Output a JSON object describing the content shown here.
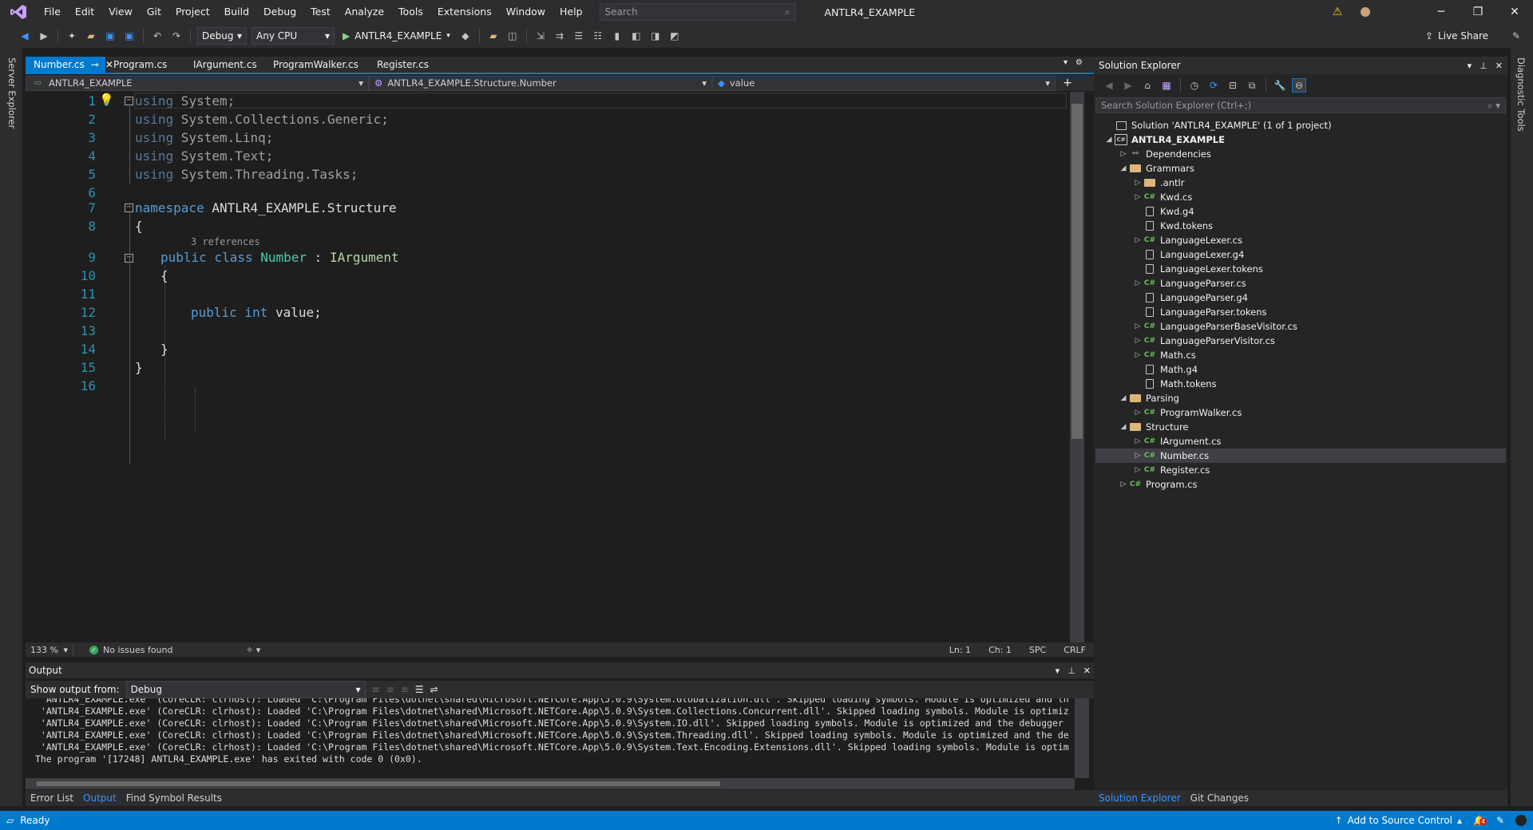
{
  "menu": {
    "items": [
      "File",
      "Edit",
      "View",
      "Git",
      "Project",
      "Build",
      "Debug",
      "Test",
      "Analyze",
      "Tools",
      "Extensions",
      "Window",
      "Help"
    ],
    "search_placeholder": "Search",
    "app_title": "ANTLR4_EXAMPLE"
  },
  "toolbar": {
    "config": "Debug",
    "platform": "Any CPU",
    "run_target": "ANTLR4_EXAMPLE",
    "live_share": "Live Share"
  },
  "side": {
    "left_label": "Server Explorer",
    "right_label": "Diagnostic Tools"
  },
  "tabs": [
    {
      "label": "Number.cs",
      "active": true
    },
    {
      "label": "Program.cs"
    },
    {
      "label": "IArgument.cs"
    },
    {
      "label": "ProgramWalker.cs"
    },
    {
      "label": "Register.cs"
    }
  ],
  "navbar": {
    "project": "ANTLR4_EXAMPLE",
    "type": "ANTLR4_EXAMPLE.Structure.Number",
    "member": "value"
  },
  "editor": {
    "line_numbers": [
      "1",
      "2",
      "3",
      "4",
      "5",
      "6",
      "7",
      "8",
      "9",
      "10",
      "11",
      "12",
      "13",
      "14",
      "15",
      "16"
    ],
    "codelens": "3 references",
    "zoom": "133 %",
    "issues": "No issues found",
    "ln": "Ln: 1",
    "ch": "Ch: 1",
    "spc": "SPC",
    "crlf": "CRLF"
  },
  "code": {
    "l1_kw": "using",
    "l1_rest": " System;",
    "l2_kw": "using",
    "l2_rest": " System.Collections.Generic;",
    "l3_kw": "using",
    "l3_rest": " System.Linq;",
    "l4_kw": "using",
    "l4_rest": " System.Text;",
    "l5_kw": "using",
    "l5_rest": " System.Threading.Tasks;",
    "l7_kw": "namespace",
    "l7_rest": " ANTLR4_EXAMPLE.Structure",
    "l8": "{",
    "l9_kw": "public class",
    "l9_type": "Number",
    "l9_colon": " : ",
    "l9_iface": "IArgument",
    "l10": "{",
    "l12_kw": "public int",
    "l12_rest": " value;",
    "l14": "}",
    "l15": "}"
  },
  "output": {
    "title": "Output",
    "show_from_label": "Show output from:",
    "source": "Debug",
    "lines": [
      " 'ANTLR4_EXAMPLE.exe' (CoreCLR: clrhost): Loaded 'C:\\Program Files\\dotnet\\shared\\Microsoft.NETCore.App\\5.0.9\\System.Globalization.dll'. Skipped loading symbols. Module is optimized and th",
      " 'ANTLR4_EXAMPLE.exe' (CoreCLR: clrhost): Loaded 'C:\\Program Files\\dotnet\\shared\\Microsoft.NETCore.App\\5.0.9\\System.Collections.Concurrent.dll'. Skipped loading symbols. Module is optimiz",
      " 'ANTLR4_EXAMPLE.exe' (CoreCLR: clrhost): Loaded 'C:\\Program Files\\dotnet\\shared\\Microsoft.NETCore.App\\5.0.9\\System.IO.dll'. Skipped loading symbols. Module is optimized and the debugger",
      " 'ANTLR4_EXAMPLE.exe' (CoreCLR: clrhost): Loaded 'C:\\Program Files\\dotnet\\shared\\Microsoft.NETCore.App\\5.0.9\\System.Threading.dll'. Skipped loading symbols. Module is optimized and the de",
      " 'ANTLR4_EXAMPLE.exe' (CoreCLR: clrhost): Loaded 'C:\\Program Files\\dotnet\\shared\\Microsoft.NETCore.App\\5.0.9\\System.Text.Encoding.Extensions.dll'. Skipped loading symbols. Module is optim",
      "The program '[17248] ANTLR4_EXAMPLE.exe' has exited with code 0 (0x0)."
    ]
  },
  "bottom_tabs": [
    "Error List",
    "Output",
    "Find Symbol Results"
  ],
  "solution_explorer": {
    "title": "Solution Explorer",
    "search_placeholder": "Search Solution Explorer (Ctrl+;)",
    "tree": [
      {
        "label": "Solution 'ANTLR4_EXAMPLE' (1 of 1 project)",
        "depth": 0,
        "icon": "solution",
        "exp": ""
      },
      {
        "label": "ANTLR4_EXAMPLE",
        "depth": 0,
        "icon": "project",
        "exp": "open",
        "bold": true
      },
      {
        "label": "Dependencies",
        "depth": 1,
        "icon": "deps",
        "exp": "closed"
      },
      {
        "label": "Grammars",
        "depth": 1,
        "icon": "folder",
        "exp": "open"
      },
      {
        "label": ".antlr",
        "depth": 2,
        "icon": "folder",
        "exp": "closed"
      },
      {
        "label": "Kwd.cs",
        "depth": 2,
        "icon": "cs",
        "exp": "closed"
      },
      {
        "label": "Kwd.g4",
        "depth": 2,
        "icon": "file",
        "exp": ""
      },
      {
        "label": "Kwd.tokens",
        "depth": 2,
        "icon": "file",
        "exp": ""
      },
      {
        "label": "LanguageLexer.cs",
        "depth": 2,
        "icon": "cs",
        "exp": "closed"
      },
      {
        "label": "LanguageLexer.g4",
        "depth": 2,
        "icon": "file",
        "exp": ""
      },
      {
        "label": "LanguageLexer.tokens",
        "depth": 2,
        "icon": "file",
        "exp": ""
      },
      {
        "label": "LanguageParser.cs",
        "depth": 2,
        "icon": "cs",
        "exp": "closed"
      },
      {
        "label": "LanguageParser.g4",
        "depth": 2,
        "icon": "file",
        "exp": ""
      },
      {
        "label": "LanguageParser.tokens",
        "depth": 2,
        "icon": "file",
        "exp": ""
      },
      {
        "label": "LanguageParserBaseVisitor.cs",
        "depth": 2,
        "icon": "cs",
        "exp": "closed"
      },
      {
        "label": "LanguageParserVisitor.cs",
        "depth": 2,
        "icon": "cs",
        "exp": "closed"
      },
      {
        "label": "Math.cs",
        "depth": 2,
        "icon": "cs",
        "exp": "closed"
      },
      {
        "label": "Math.g4",
        "depth": 2,
        "icon": "file",
        "exp": ""
      },
      {
        "label": "Math.tokens",
        "depth": 2,
        "icon": "file",
        "exp": ""
      },
      {
        "label": "Parsing",
        "depth": 1,
        "icon": "folder",
        "exp": "open"
      },
      {
        "label": "ProgramWalker.cs",
        "depth": 2,
        "icon": "cs",
        "exp": "closed"
      },
      {
        "label": "Structure",
        "depth": 1,
        "icon": "folder",
        "exp": "open"
      },
      {
        "label": "IArgument.cs",
        "depth": 2,
        "icon": "cs",
        "exp": "closed"
      },
      {
        "label": "Number.cs",
        "depth": 2,
        "icon": "cs",
        "exp": "closed",
        "selected": true
      },
      {
        "label": "Register.cs",
        "depth": 2,
        "icon": "cs",
        "exp": "closed"
      },
      {
        "label": "Program.cs",
        "depth": 1,
        "icon": "cs",
        "exp": "closed"
      }
    ],
    "bottom_tabs": [
      "Solution Explorer",
      "Git Changes"
    ]
  },
  "status": {
    "ready": "Ready",
    "source_control": "Add to Source Control",
    "notifications": "4"
  },
  "colors": {
    "accent": "#007acc",
    "keyword": "#569cd6",
    "type": "#4ec9b0",
    "line_number": "#2b91af"
  }
}
